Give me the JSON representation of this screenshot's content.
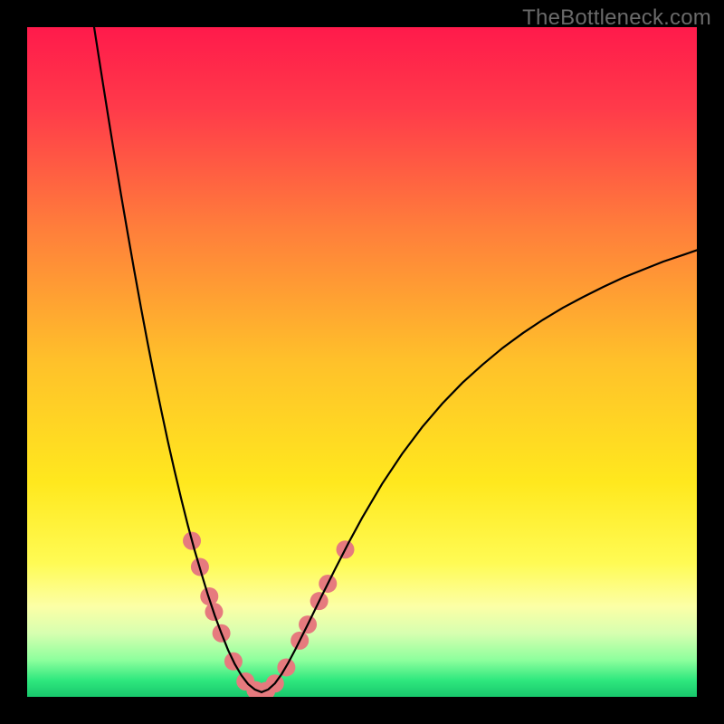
{
  "watermark": "TheBottleneck.com",
  "chart_data": {
    "type": "line",
    "title": "",
    "xlabel": "",
    "ylabel": "",
    "xlim": [
      0,
      100
    ],
    "ylim": [
      0,
      100
    ],
    "background_gradient": {
      "stops": [
        {
          "offset": 0.0,
          "color": "#ff1a4b"
        },
        {
          "offset": 0.12,
          "color": "#ff3a4a"
        },
        {
          "offset": 0.3,
          "color": "#ff7e3b"
        },
        {
          "offset": 0.5,
          "color": "#ffc12a"
        },
        {
          "offset": 0.68,
          "color": "#ffe81e"
        },
        {
          "offset": 0.8,
          "color": "#fffb54"
        },
        {
          "offset": 0.865,
          "color": "#fcffa6"
        },
        {
          "offset": 0.905,
          "color": "#d7ffb0"
        },
        {
          "offset": 0.945,
          "color": "#8dff9d"
        },
        {
          "offset": 0.975,
          "color": "#2fe87e"
        },
        {
          "offset": 1.0,
          "color": "#18c76c"
        }
      ]
    },
    "series": [
      {
        "name": "left-curve",
        "color": "#000000",
        "width": 2.2,
        "points": [
          {
            "x": 10.0,
            "y": 100.0
          },
          {
            "x": 11.0,
            "y": 93.6
          },
          {
            "x": 12.0,
            "y": 87.3
          },
          {
            "x": 13.0,
            "y": 81.1
          },
          {
            "x": 14.0,
            "y": 75.1
          },
          {
            "x": 15.0,
            "y": 69.3
          },
          {
            "x": 16.0,
            "y": 63.6
          },
          {
            "x": 17.0,
            "y": 58.1
          },
          {
            "x": 18.0,
            "y": 52.8
          },
          {
            "x": 19.0,
            "y": 47.7
          },
          {
            "x": 20.0,
            "y": 42.9
          },
          {
            "x": 21.0,
            "y": 38.2
          },
          {
            "x": 22.0,
            "y": 33.8
          },
          {
            "x": 23.0,
            "y": 29.6
          },
          {
            "x": 24.0,
            "y": 25.6
          },
          {
            "x": 25.0,
            "y": 21.9
          },
          {
            "x": 26.0,
            "y": 18.5
          },
          {
            "x": 27.0,
            "y": 15.2
          },
          {
            "x": 28.0,
            "y": 12.2
          },
          {
            "x": 29.0,
            "y": 9.5
          },
          {
            "x": 30.0,
            "y": 7.0
          },
          {
            "x": 31.0,
            "y": 4.9
          },
          {
            "x": 32.0,
            "y": 3.2
          },
          {
            "x": 33.0,
            "y": 1.9
          },
          {
            "x": 34.0,
            "y": 1.1
          },
          {
            "x": 35.0,
            "y": 0.7
          }
        ]
      },
      {
        "name": "right-curve",
        "color": "#000000",
        "width": 2.2,
        "points": [
          {
            "x": 35.0,
            "y": 0.7
          },
          {
            "x": 36.0,
            "y": 1.1
          },
          {
            "x": 37.0,
            "y": 2.0
          },
          {
            "x": 38.0,
            "y": 3.4
          },
          {
            "x": 39.0,
            "y": 5.1
          },
          {
            "x": 40.0,
            "y": 7.0
          },
          {
            "x": 42.0,
            "y": 11.0
          },
          {
            "x": 44.0,
            "y": 15.1
          },
          {
            "x": 46.0,
            "y": 19.1
          },
          {
            "x": 48.0,
            "y": 23.0
          },
          {
            "x": 50.0,
            "y": 26.7
          },
          {
            "x": 53.0,
            "y": 31.8
          },
          {
            "x": 56.0,
            "y": 36.3
          },
          {
            "x": 59.0,
            "y": 40.3
          },
          {
            "x": 62.0,
            "y": 43.8
          },
          {
            "x": 65.0,
            "y": 46.9
          },
          {
            "x": 68.0,
            "y": 49.6
          },
          {
            "x": 71.0,
            "y": 52.1
          },
          {
            "x": 74.0,
            "y": 54.3
          },
          {
            "x": 77.0,
            "y": 56.3
          },
          {
            "x": 80.0,
            "y": 58.1
          },
          {
            "x": 83.0,
            "y": 59.7
          },
          {
            "x": 86.0,
            "y": 61.2
          },
          {
            "x": 89.0,
            "y": 62.6
          },
          {
            "x": 92.0,
            "y": 63.8
          },
          {
            "x": 95.0,
            "y": 65.0
          },
          {
            "x": 98.0,
            "y": 66.0
          },
          {
            "x": 100.0,
            "y": 66.7
          }
        ]
      }
    ],
    "markers": {
      "color": "#e67a7e",
      "radius": 10,
      "points": [
        {
          "x": 24.6,
          "y": 23.3
        },
        {
          "x": 25.8,
          "y": 19.4
        },
        {
          "x": 27.2,
          "y": 15.0
        },
        {
          "x": 27.9,
          "y": 12.7
        },
        {
          "x": 29.0,
          "y": 9.5
        },
        {
          "x": 30.8,
          "y": 5.3
        },
        {
          "x": 32.6,
          "y": 2.3
        },
        {
          "x": 34.1,
          "y": 1.0
        },
        {
          "x": 35.7,
          "y": 0.9
        },
        {
          "x": 37.0,
          "y": 2.0
        },
        {
          "x": 38.7,
          "y": 4.4
        },
        {
          "x": 40.7,
          "y": 8.4
        },
        {
          "x": 41.9,
          "y": 10.8
        },
        {
          "x": 43.6,
          "y": 14.3
        },
        {
          "x": 44.9,
          "y": 16.9
        },
        {
          "x": 47.5,
          "y": 22.0
        }
      ]
    }
  }
}
